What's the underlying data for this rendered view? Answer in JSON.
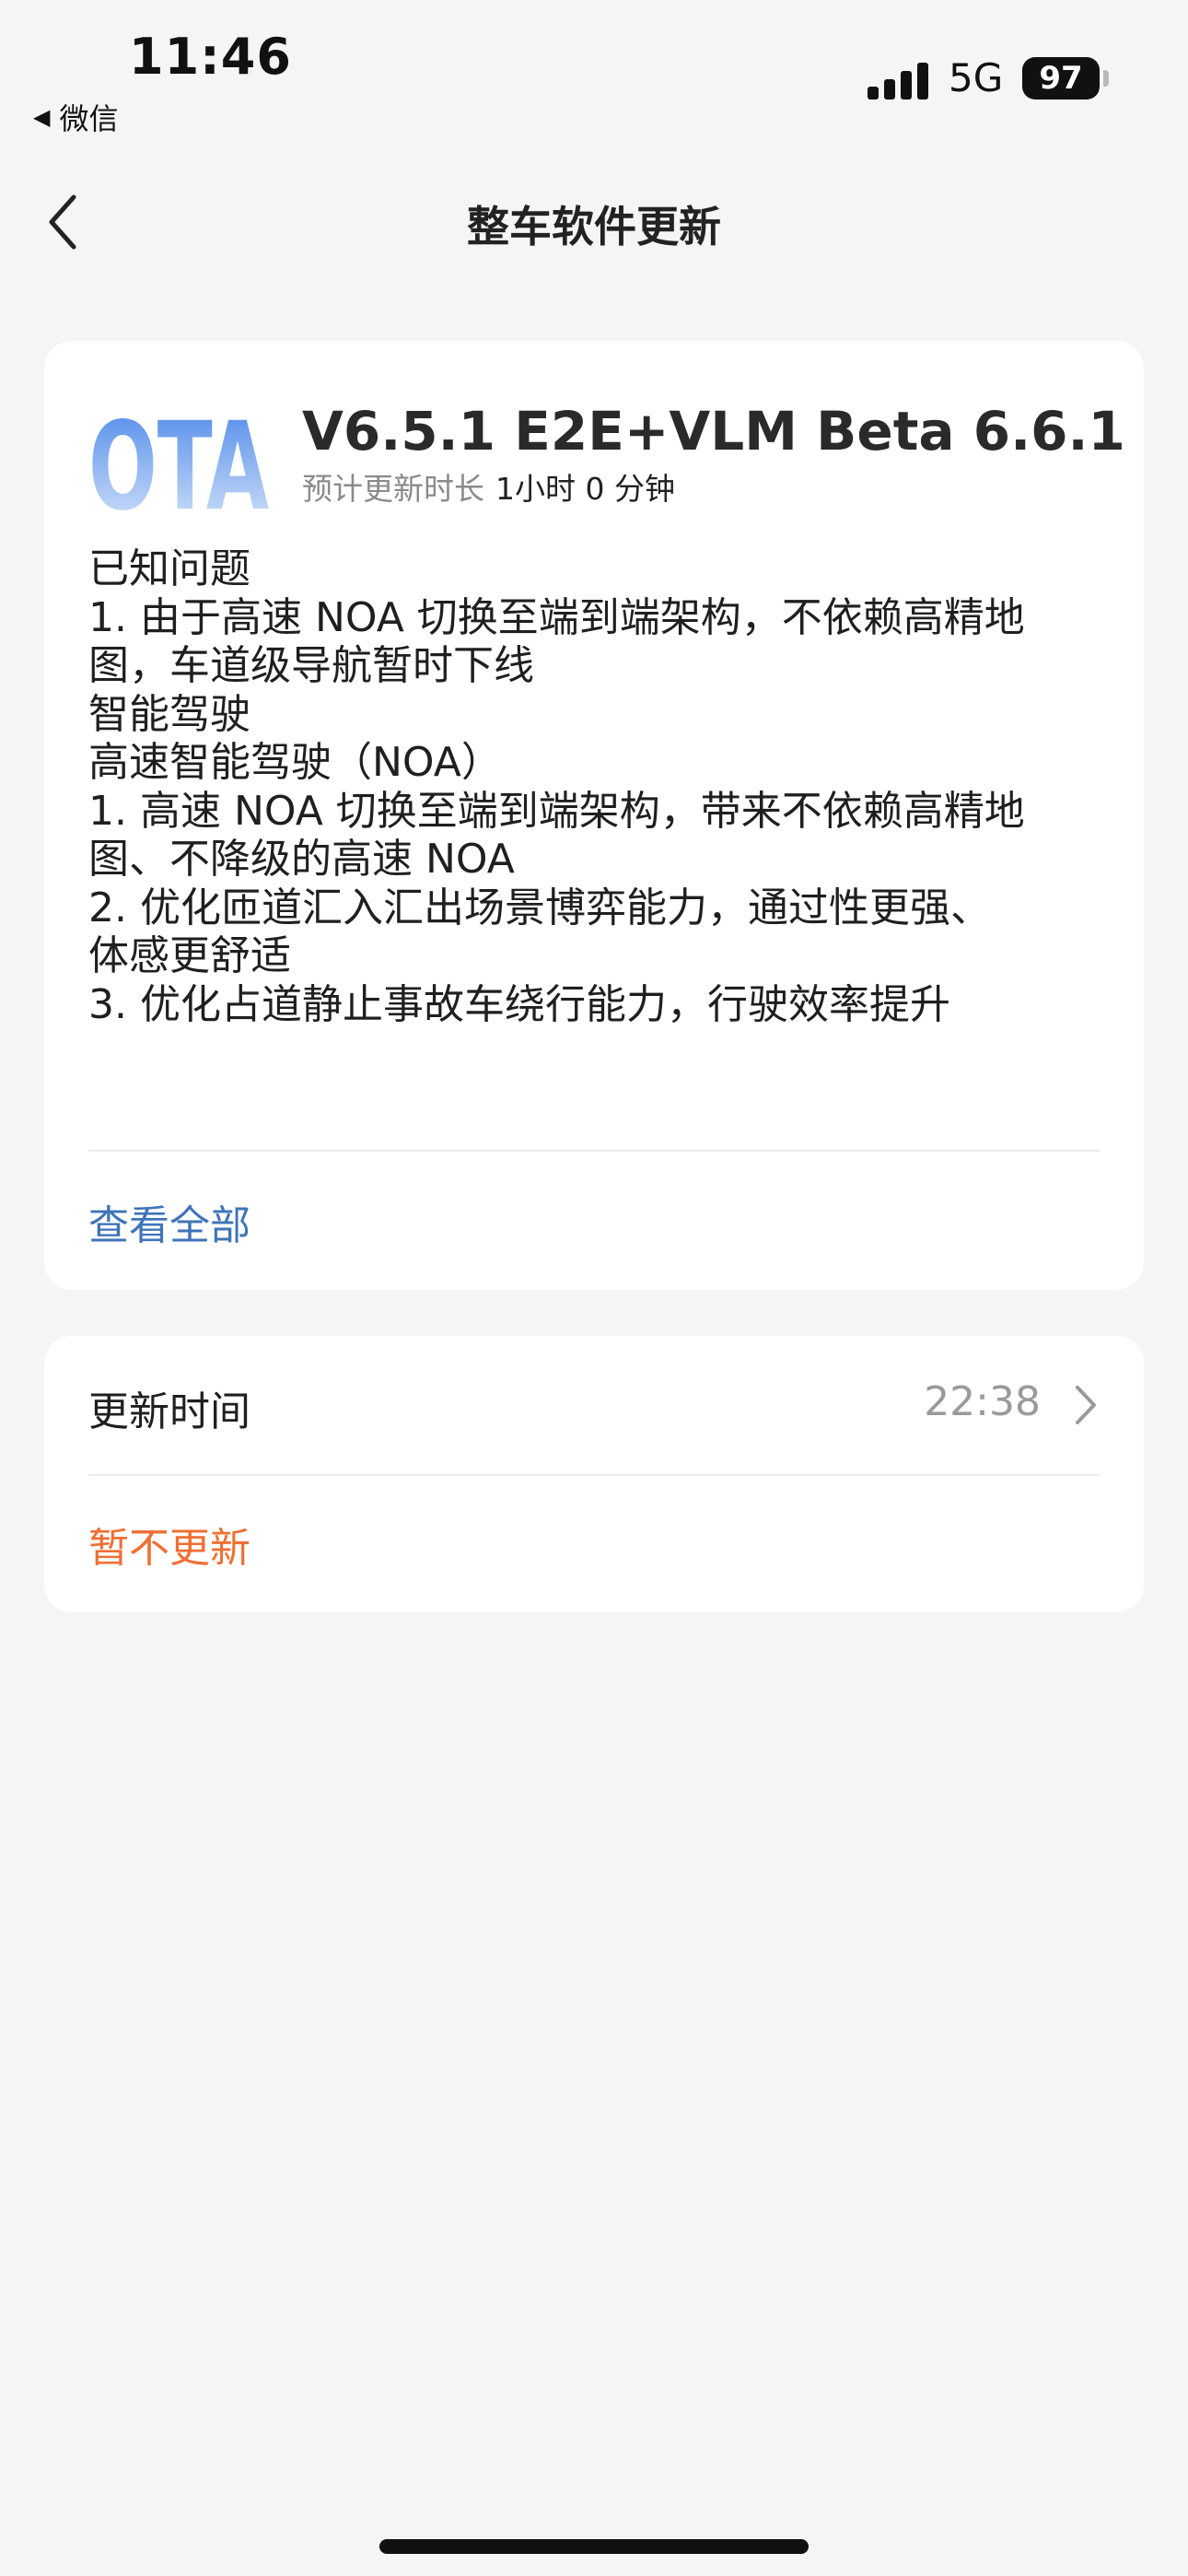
{
  "status_bar": {
    "time": "11:46",
    "back_app_label": "微信",
    "back_arrow": "◀",
    "signal_icon": "cellular-signal-icon",
    "network": "5G",
    "battery_level": "97",
    "battery_percent": 97
  },
  "nav": {
    "back_icon": "chevron-left-icon",
    "title": "整车软件更新"
  },
  "update": {
    "logo_text": "OTA",
    "version": "V6.5.1 E2E+VLM Beta 6.6.1",
    "duration_label": "预计更新时长",
    "duration_value": "1小时 0 分钟",
    "notes": [
      "已知问题",
      "1. 由于高速 NOA 切换至端到端架构，不依赖高精地",
      "图，车道级导航暂时下线",
      "智能驾驶",
      "高速智能驾驶（NOA）",
      "1. 高速 NOA 切换至端到端架构，带来不依赖高精地",
      "图、不降级的高速 NOA",
      "2. 优化匝道汇入汇出场景博弈能力，通过性更强、",
      "体感更舒适",
      "3. 优化占道静止事故车绕行能力，行驶效率提升"
    ],
    "view_all_label": "查看全部"
  },
  "schedule": {
    "update_time_label": "更新时间",
    "update_time_value": "22:38",
    "chevron_icon": "chevron-right-icon",
    "skip_label": "暂不更新"
  },
  "colors": {
    "page_background": "#f5f5f5",
    "card_background": "#ffffff",
    "link_blue": "#3f74b8",
    "warning_orange": "#ef6f33",
    "secondary_gray": "#9a9a9a",
    "ota_gradient_top": "#4a86e8",
    "ota_gradient_bottom": "#dbe8fb"
  }
}
